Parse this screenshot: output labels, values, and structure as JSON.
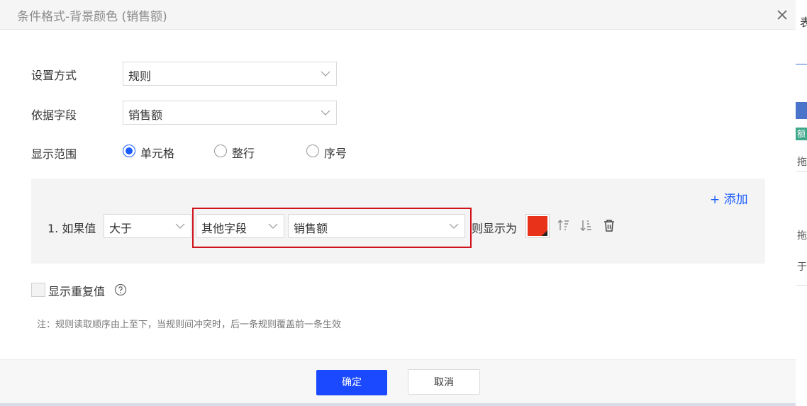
{
  "background_page": {
    "title_fragment": "表",
    "tag_fragment": "额",
    "row1_fragment": "拖入",
    "row2_fragment": "拖入",
    "row3_fragment": "于"
  },
  "dialog": {
    "title": "条件格式-背景颜色 (销售额)",
    "close_icon": "close-icon"
  },
  "form": {
    "setting_mode": {
      "label": "设置方式",
      "value": "规则"
    },
    "base_field": {
      "label": "依据字段",
      "value": "销售额"
    },
    "display_range": {
      "label": "显示范围",
      "options": [
        {
          "label": "单元格",
          "checked": true
        },
        {
          "label": "整行",
          "checked": false
        },
        {
          "label": "序号",
          "checked": false
        }
      ]
    }
  },
  "rules": {
    "add_label": "+ 添加",
    "items": [
      {
        "index_label": "1. 如果值",
        "operator": "大于",
        "compare_type": "其他字段",
        "compare_field": "销售额",
        "then_label": "则显示为",
        "color": "#e8321a"
      }
    ],
    "icons": {
      "move_up": "sort-up-icon",
      "move_down": "sort-down-icon",
      "delete": "trash-icon"
    }
  },
  "show_duplicates": {
    "label": "显示重复值",
    "checked": false,
    "help_icon": "help-icon"
  },
  "note": "注：规则读取顺序由上至下，当规则间冲突时，后一条规则覆盖前一条生效",
  "footer": {
    "ok_label": "确定",
    "cancel_label": "取消"
  },
  "colors": {
    "primary": "#1a49ff",
    "radio_accent": "#1a5cff",
    "highlight_border": "#d0121b"
  }
}
